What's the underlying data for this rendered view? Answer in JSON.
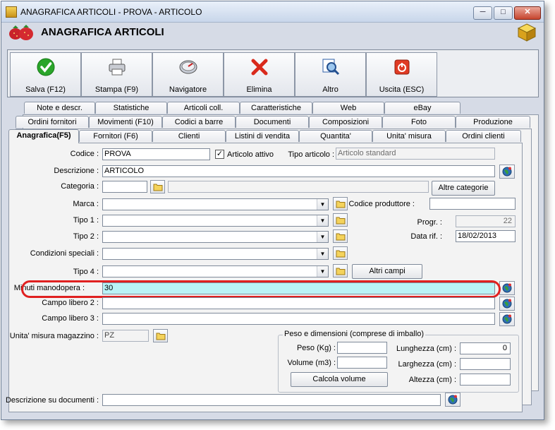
{
  "window": {
    "title": "ANAGRAFICA ARTICOLI - PROVA - ARTICOLO",
    "minimize": "─",
    "maximize": "□",
    "close": "✕"
  },
  "header": {
    "title": "ANAGRAFICA ARTICOLI"
  },
  "toolbar": [
    {
      "name": "save-button",
      "icon": "check-icon",
      "label": "Salva (F12)"
    },
    {
      "name": "print-button",
      "icon": "printer-icon",
      "label": "Stampa (F9)"
    },
    {
      "name": "navigator-button",
      "icon": "compass-icon",
      "label": "Navigatore"
    },
    {
      "name": "delete-button",
      "icon": "red-x-icon",
      "label": "Elimina"
    },
    {
      "name": "other-button",
      "icon": "magnifier-icon",
      "label": "Altro"
    },
    {
      "name": "exit-button",
      "icon": "power-icon",
      "label": "Uscita (ESC)"
    }
  ],
  "tabs": {
    "row1": [
      "Note e descr.",
      "Statistiche",
      "Articoli coll.",
      "Caratteristiche",
      "Web",
      "eBay"
    ],
    "row2": [
      "Ordini fornitori",
      "Movimenti (F10)",
      "Codici a barre",
      "Documenti",
      "Composizioni",
      "Foto",
      "Produzione"
    ],
    "row3": [
      "Anagrafica(F5)",
      "Fornitori (F6)",
      "Clienti",
      "Listini di vendita",
      "Quantita'",
      "Unita' misura",
      "Ordini clienti"
    ]
  },
  "form": {
    "codice_label": "Codice :",
    "codice_value": "PROVA",
    "articolo_attivo_label": "Articolo attivo",
    "articolo_attivo_check": "✓",
    "tipo_articolo_label": "Tipo articolo :",
    "tipo_articolo_value": "Articolo standard",
    "descrizione_label": "Descrizione :",
    "descrizione_value": "ARTICOLO",
    "categoria_label": "Categoria :",
    "altre_categorie_label": "Altre categorie",
    "marca_label": "Marca :",
    "codice_produttore_label": "Codice produttore :",
    "tipo1_label": "Tipo 1 :",
    "progr_label": "Progr. :",
    "progr_value": "22",
    "tipo2_label": "Tipo 2 :",
    "data_rif_label": "Data rif. :",
    "data_rif_value": "18/02/2013",
    "condizioni_label": "Condizioni speciali :",
    "tipo4_label": "Tipo 4 :",
    "altri_campi_label": "Altri campi",
    "minuti_label": "Minuti manodopera :",
    "minuti_value": "30",
    "campo2_label": "Campo libero 2 :",
    "campo3_label": "Campo libero 3 :",
    "um_label": "Unita' misura magazzino :",
    "um_value": "PZ",
    "peso_group_label": "Peso e dimensioni (comprese di imballo)",
    "peso_label": "Peso (Kg) :",
    "volume_label": "Volume (m3) :",
    "calcola_label": "Calcola volume",
    "lunghezza_label": "Lunghezza (cm) :",
    "lunghezza_value": "0",
    "larghezza_label": "Larghezza (cm) :",
    "altezza_label": "Altezza (cm) :",
    "desc_doc_label": "Descrizione su documenti :"
  }
}
